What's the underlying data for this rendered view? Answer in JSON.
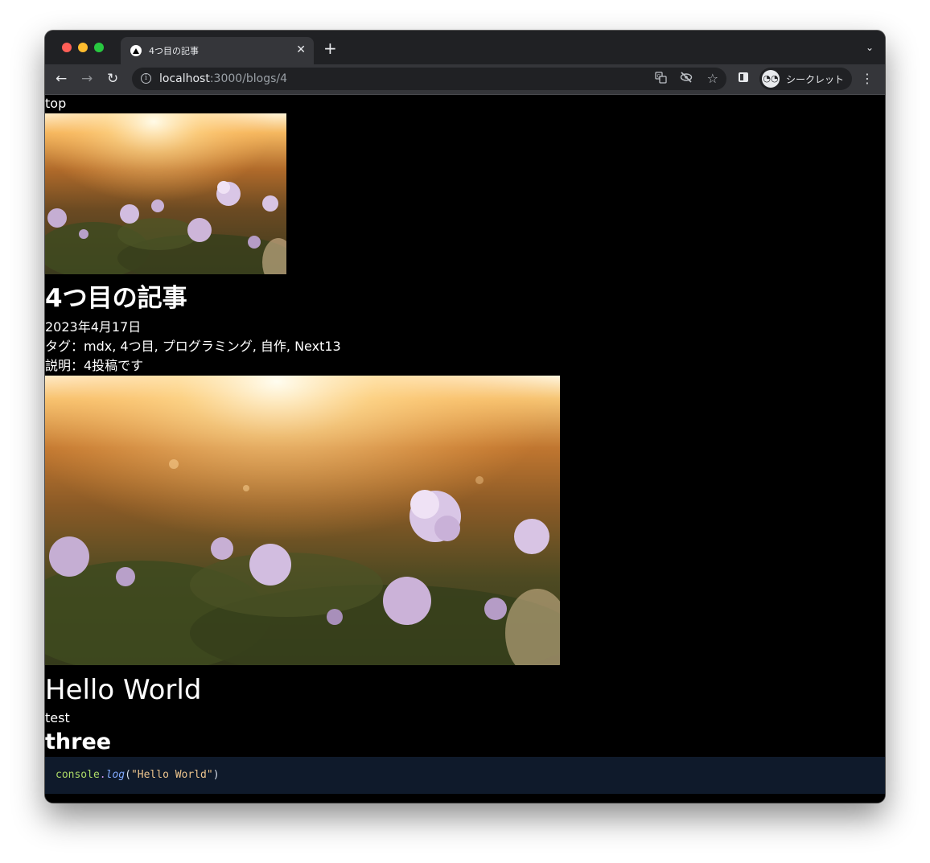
{
  "browser": {
    "tab": {
      "title": "4つ目の記事",
      "close_glyph": "✕"
    },
    "new_tab_glyph": "+",
    "tab_search_glyph": "⌄",
    "nav": {
      "back": "←",
      "forward": "→",
      "reload": "↻"
    },
    "address": {
      "host": "localhost",
      "rest": ":3000/blogs/4"
    },
    "omnibox_icons": [
      "translate-icon",
      "eye-off-icon",
      "star-icon"
    ],
    "profile_label": "シークレット",
    "menu_glyph": "⋮"
  },
  "page": {
    "top_link": "top",
    "post": {
      "title": "4つ目の記事",
      "date": "2023年4月17日",
      "tags": "タグ：mdx, 4つ目, プログラミング, 自作, Next13",
      "description": "説明：4投稿です"
    },
    "content": {
      "heading1": "Hello World",
      "paragraph": "test",
      "heading2": "three",
      "code": {
        "object": "console",
        "dot": ".",
        "method": "log",
        "open": "(",
        "string": "\"Hello World\"",
        "close": ")"
      }
    }
  },
  "colors": {
    "page_bg": "#000000",
    "tabstrip": "#202124",
    "toolbar": "#35363a",
    "code_bg": "#0f1a2b"
  }
}
